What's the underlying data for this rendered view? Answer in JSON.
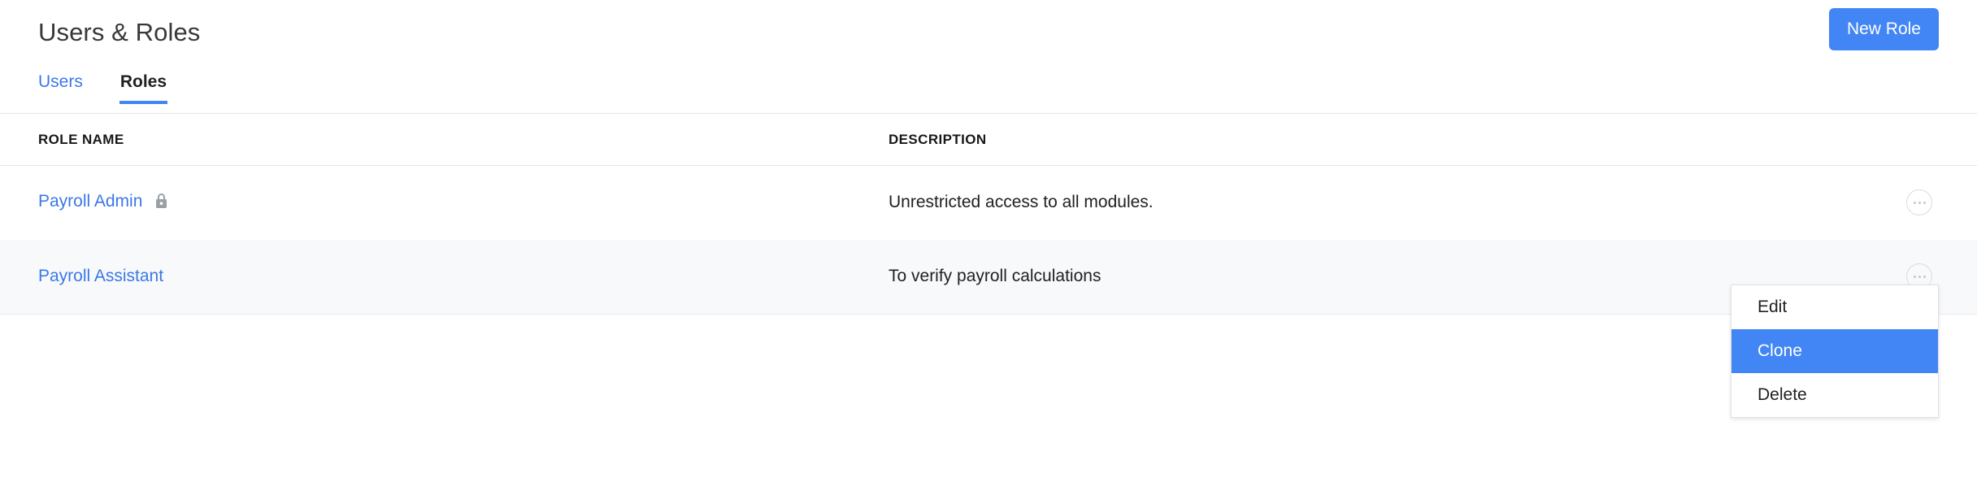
{
  "header": {
    "title": "Users & Roles",
    "new_role_label": "New Role",
    "accent_color": "#4285f4"
  },
  "tabs": [
    {
      "label": "Users",
      "active": false
    },
    {
      "label": "Roles",
      "active": true
    }
  ],
  "table": {
    "columns": [
      "ROLE NAME",
      "DESCRIPTION"
    ],
    "rows": [
      {
        "role_name": "Payroll Admin",
        "description": "Unrestricted access to all modules.",
        "locked": true
      },
      {
        "role_name": "Payroll Assistant",
        "description": "To verify payroll calculations",
        "locked": false
      }
    ]
  },
  "context_menu": {
    "items": [
      {
        "label": "Edit",
        "highlighted": false
      },
      {
        "label": "Clone",
        "highlighted": true
      },
      {
        "label": "Delete",
        "highlighted": false
      }
    ],
    "highlight_color": "#4285f4"
  },
  "icons": {
    "lock": "lock-icon",
    "kebab": "more-options-icon"
  }
}
